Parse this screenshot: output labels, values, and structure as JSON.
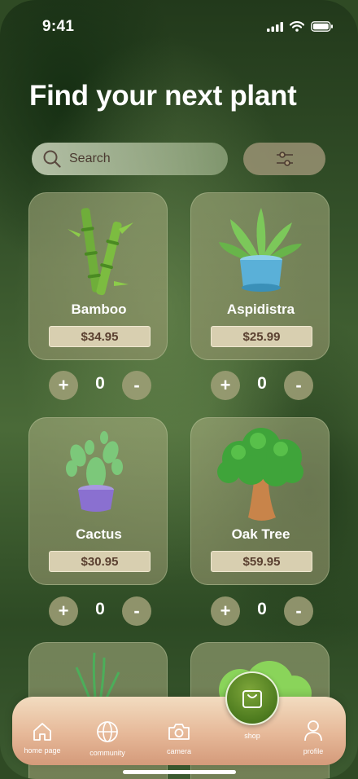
{
  "status": {
    "time": "9:41"
  },
  "header": {
    "title": "Find your next plant"
  },
  "search": {
    "placeholder": "Search"
  },
  "plants": [
    {
      "name": "Bamboo",
      "price": "$34.95",
      "qty": "0"
    },
    {
      "name": "Aspidistra",
      "price": "$25.99",
      "qty": "0"
    },
    {
      "name": "Cactus",
      "price": "$30.95",
      "qty": "0"
    },
    {
      "name": "Oak Tree",
      "price": "$59.95",
      "qty": "0"
    }
  ],
  "stepper": {
    "plus": "+",
    "minus": "-"
  },
  "tabs": {
    "home": "home page",
    "community": "community",
    "camera": "camera",
    "shop": "shop",
    "profile": "profile"
  },
  "colors": {
    "accent": "#5a8a24",
    "price_bg": "#d8cfb0",
    "tabbar": "#e6b898"
  },
  "icons": [
    "signal-icon",
    "wifi-icon",
    "battery-icon",
    "search-icon",
    "filter-icon",
    "home-icon",
    "globe-icon",
    "camera-icon",
    "shopping-bag-icon",
    "profile-icon"
  ]
}
